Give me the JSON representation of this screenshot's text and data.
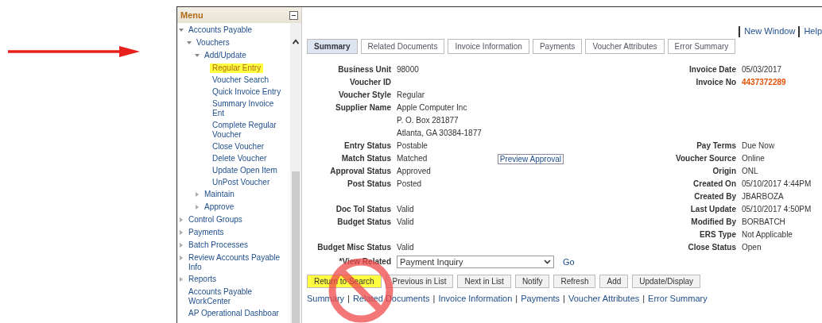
{
  "menu": {
    "title": "Menu",
    "items": [
      {
        "label": "Accounts Payable",
        "expanded": true,
        "selected": false,
        "children": [
          {
            "label": "Vouchers",
            "expanded": true,
            "selected": false,
            "children": [
              {
                "label": "Add/Update",
                "expanded": true,
                "selected": false,
                "children": [
                  {
                    "label": "Regular Entry",
                    "selected": true
                  },
                  {
                    "label": "Voucher Search",
                    "selected": false
                  },
                  {
                    "label": "Quick Invoice Entry",
                    "selected": false
                  },
                  {
                    "label": "Summary Invoice Ent",
                    "selected": false
                  },
                  {
                    "label": "Complete Regular Voucher",
                    "selected": false
                  },
                  {
                    "label": "Close Voucher",
                    "selected": false
                  },
                  {
                    "label": "Delete Voucher",
                    "selected": false
                  },
                  {
                    "label": "Update Open Item",
                    "selected": false
                  },
                  {
                    "label": "UnPost Voucher",
                    "selected": false
                  }
                ]
              },
              {
                "label": "Maintain",
                "expanded": false,
                "selected": false
              },
              {
                "label": "Approve",
                "expanded": false,
                "selected": false
              }
            ]
          }
        ]
      },
      {
        "label": "Control Groups",
        "expanded": false,
        "selected": false
      },
      {
        "label": "Payments",
        "expanded": false,
        "selected": false
      },
      {
        "label": "Batch Processes",
        "expanded": false,
        "selected": false
      },
      {
        "label": "Review Accounts Payable Info",
        "expanded": false,
        "selected": false
      },
      {
        "label": "Reports",
        "expanded": false,
        "selected": false
      },
      {
        "label": "Accounts Payable WorkCenter",
        "selected": false
      },
      {
        "label": "AP Operational Dashboar",
        "selected": false
      }
    ]
  },
  "header_links": [
    "New Window",
    "Help"
  ],
  "tabs": [
    {
      "label": "Summary",
      "selected": true
    },
    {
      "label": "Related Documents",
      "selected": false
    },
    {
      "label": "Invoice Information",
      "selected": false
    },
    {
      "label": "Payments",
      "selected": false
    },
    {
      "label": "Voucher Attributes",
      "selected": false
    },
    {
      "label": "Error Summary",
      "selected": false
    }
  ],
  "fields": [
    {
      "label": "Business Unit",
      "value": "98000",
      "right_label": "Invoice Date",
      "right_value": "05/03/2017"
    },
    {
      "label": "Voucher ID",
      "right_label": "Invoice No",
      "right_value": "4437372289",
      "kind": "highlight"
    },
    {
      "label": "Voucher Style",
      "value": "Regular"
    },
    {
      "label": "Supplier Name",
      "value": "Apple Computer Inc"
    },
    {
      "value": "P. O. Box 281877"
    },
    {
      "value": "Atlanta, GA  30384-1877"
    },
    {
      "label": "Entry Status",
      "value": "Postable",
      "right_label": "Pay Terms",
      "right_value": "Due Now"
    },
    {
      "label": "Match Status",
      "value": "Matched",
      "right_label": "Voucher Source",
      "right_value": "Online",
      "link": "Preview Approval"
    },
    {
      "label": "Approval Status",
      "value": "Approved",
      "right_label": "Origin",
      "right_value": "ONL"
    },
    {
      "label": "Post Status",
      "value": "Posted",
      "right_label": "Created On",
      "right_value": "05/10/2017  4:44PM"
    },
    {
      "right_label": "Created By",
      "right_value": "JBARBOZA"
    },
    {
      "label": "Doc Tol Status",
      "value": "Valid",
      "right_label": "Last Update",
      "right_value": "05/10/2017  4:50PM"
    },
    {
      "label": "Budget Status",
      "value": "Valid",
      "right_label": "Modified By",
      "right_value": "BORBATCH"
    },
    {
      "right_label": "ERS Type",
      "right_value": "Not Applicable"
    },
    {
      "label": "Budget Misc Status",
      "value": "Valid",
      "right_label": "Close Status",
      "right_value": "Open"
    }
  ],
  "view_related": {
    "label": "*View Related",
    "value": "Payment Inquiry",
    "go": "Go"
  },
  "toolbar": [
    {
      "label": "Return to Search",
      "selected": true
    },
    {
      "label": "Previous in List",
      "selected": false
    },
    {
      "label": "Next in List",
      "selected": false
    },
    {
      "label": "Notify",
      "selected": false
    },
    {
      "label": "Refresh",
      "selected": false
    },
    {
      "label": "Add",
      "selected": false
    },
    {
      "label": "Update/Display",
      "selected": false
    }
  ],
  "footer": {
    "separator": "|",
    "links": [
      "Summary",
      "Related Documents",
      "Invoice Information",
      "Payments",
      "Voucher Attributes",
      "Error Summary"
    ]
  }
}
